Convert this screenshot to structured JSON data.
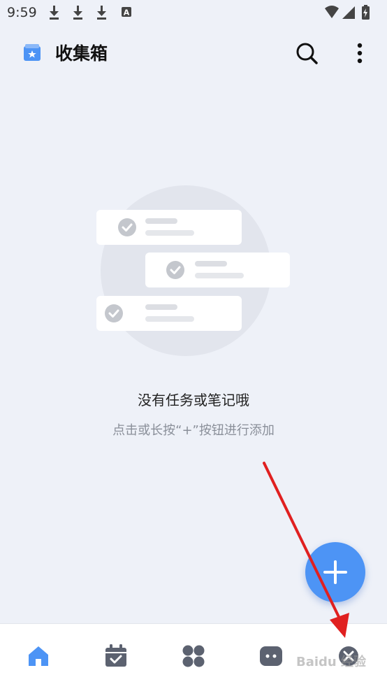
{
  "status_bar": {
    "time": "9:59",
    "left_icons": [
      "download-icon",
      "download-icon",
      "download-icon",
      "text-a-icon"
    ],
    "right_icons": [
      "wifi-icon",
      "signal-icon",
      "battery-icon"
    ]
  },
  "app_bar": {
    "title": "收集箱",
    "icon": "inbox-star-icon",
    "actions": [
      "search-icon",
      "more-vertical-icon"
    ]
  },
  "empty_state": {
    "title": "没有任务或笔记哦",
    "hint": "点击或长按“+”按钮进行添加"
  },
  "fab": {
    "icon": "plus-icon"
  },
  "bottom_nav": {
    "items": [
      {
        "icon": "home-icon",
        "active": true
      },
      {
        "icon": "calendar-check-icon",
        "active": false
      },
      {
        "icon": "grid-apps-icon",
        "active": false
      },
      {
        "icon": "chat-bubble-icon",
        "active": false
      },
      {
        "icon": "close-circle-icon",
        "active": false
      }
    ]
  },
  "colors": {
    "accent": "#4d94f5",
    "background": "#eef1f8",
    "nav_inactive": "#5c6270",
    "annotation_arrow": "#e02020"
  },
  "watermark": "Baidu 经验"
}
